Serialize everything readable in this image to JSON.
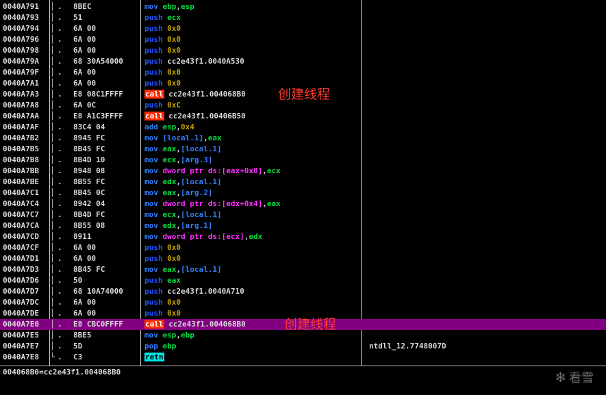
{
  "disasm_rows": [
    {
      "addr": "0040A791",
      "bracket": "│",
      "dot": ".",
      "hex": "8BEC",
      "mnemonic": "mov",
      "m_class": "m-mov",
      "parts": [
        {
          "t": "ebp",
          "c": "o-reg"
        },
        {
          "t": ",",
          "c": "o-target"
        },
        {
          "t": "esp",
          "c": "o-reg"
        }
      ],
      "note": "",
      "comment": ""
    },
    {
      "addr": "0040A793",
      "bracket": "│",
      "dot": ".",
      "hex": "51",
      "mnemonic": "push",
      "m_class": "m-push",
      "parts": [
        {
          "t": "ecx",
          "c": "o-reg"
        }
      ],
      "note": "",
      "comment": ""
    },
    {
      "addr": "0040A794",
      "bracket": "│",
      "dot": ".",
      "hex": "6A 00",
      "mnemonic": "push",
      "m_class": "m-push",
      "parts": [
        {
          "t": "0x0",
          "c": "o-imm"
        }
      ],
      "note": "",
      "comment": ""
    },
    {
      "addr": "0040A796",
      "bracket": "│",
      "dot": ".",
      "hex": "6A 00",
      "mnemonic": "push",
      "m_class": "m-push",
      "parts": [
        {
          "t": "0x0",
          "c": "o-imm"
        }
      ],
      "note": "",
      "comment": ""
    },
    {
      "addr": "0040A798",
      "bracket": "│",
      "dot": ".",
      "hex": "6A 00",
      "mnemonic": "push",
      "m_class": "m-push",
      "parts": [
        {
          "t": "0x0",
          "c": "o-imm"
        }
      ],
      "note": "",
      "comment": ""
    },
    {
      "addr": "0040A79A",
      "bracket": "│",
      "dot": ".",
      "hex": "68 30A54000",
      "mnemonic": "push",
      "m_class": "m-push",
      "parts": [
        {
          "t": "cc2e43f1.0040A530",
          "c": "o-target"
        }
      ],
      "note": "",
      "comment": ""
    },
    {
      "addr": "0040A79F",
      "bracket": "│",
      "dot": ".",
      "hex": "6A 00",
      "mnemonic": "push",
      "m_class": "m-push",
      "parts": [
        {
          "t": "0x0",
          "c": "o-imm"
        }
      ],
      "note": "",
      "comment": ""
    },
    {
      "addr": "0040A7A1",
      "bracket": "│",
      "dot": ".",
      "hex": "6A 00",
      "mnemonic": "push",
      "m_class": "m-push",
      "parts": [
        {
          "t": "0x0",
          "c": "o-imm"
        }
      ],
      "note": "",
      "comment": ""
    },
    {
      "addr": "0040A7A3",
      "bracket": "│",
      "dot": ".",
      "hex": "E8 08C1FFFF",
      "mnemonic": "call",
      "m_class": "m-call",
      "parts": [
        {
          "t": "cc2e43f1.004068B0",
          "c": "o-target"
        }
      ],
      "note": "创建线程",
      "comment": ""
    },
    {
      "addr": "0040A7A8",
      "bracket": "│",
      "dot": ".",
      "hex": "6A 0C",
      "mnemonic": "push",
      "m_class": "m-push",
      "parts": [
        {
          "t": "0xC",
          "c": "o-imm"
        }
      ],
      "note": "",
      "comment": ""
    },
    {
      "addr": "0040A7AA",
      "bracket": "│",
      "dot": ".",
      "hex": "E8 A1C3FFFF",
      "mnemonic": "call",
      "m_class": "m-call",
      "parts": [
        {
          "t": "cc2e43f1.00406B50",
          "c": "o-target"
        }
      ],
      "note": "",
      "comment": ""
    },
    {
      "addr": "0040A7AF",
      "bracket": "│",
      "dot": ".",
      "hex": "83C4 04",
      "mnemonic": "add",
      "m_class": "m-add",
      "parts": [
        {
          "t": "esp",
          "c": "o-reg"
        },
        {
          "t": ",",
          "c": "o-target"
        },
        {
          "t": "0x4",
          "c": "o-imm"
        }
      ],
      "note": "",
      "comment": ""
    },
    {
      "addr": "0040A7B2",
      "bracket": "│",
      "dot": ".",
      "hex": "8945 FC",
      "mnemonic": "mov",
      "m_class": "m-mov",
      "parts": [
        {
          "t": "[local.1]",
          "c": "o-local"
        },
        {
          "t": ",",
          "c": "o-target"
        },
        {
          "t": "eax",
          "c": "o-reg"
        }
      ],
      "note": "",
      "comment": ""
    },
    {
      "addr": "0040A7B5",
      "bracket": "│",
      "dot": ".",
      "hex": "8B45 FC",
      "mnemonic": "mov",
      "m_class": "m-mov",
      "parts": [
        {
          "t": "eax",
          "c": "o-reg"
        },
        {
          "t": ",",
          "c": "o-target"
        },
        {
          "t": "[local.1]",
          "c": "o-local"
        }
      ],
      "note": "",
      "comment": ""
    },
    {
      "addr": "0040A7B8",
      "bracket": "│",
      "dot": ".",
      "hex": "8B4D 10",
      "mnemonic": "mov",
      "m_class": "m-mov",
      "parts": [
        {
          "t": "ecx",
          "c": "o-reg"
        },
        {
          "t": ",",
          "c": "o-target"
        },
        {
          "t": "[arg.3]",
          "c": "o-local"
        }
      ],
      "note": "",
      "comment": ""
    },
    {
      "addr": "0040A7BB",
      "bracket": "│",
      "dot": ".",
      "hex": "8948 08",
      "mnemonic": "mov",
      "m_class": "m-mov",
      "parts": [
        {
          "t": "dword ptr ds:[eax+0x8]",
          "c": "o-dword"
        },
        {
          "t": ",",
          "c": "o-target"
        },
        {
          "t": "ecx",
          "c": "o-reg"
        }
      ],
      "note": "",
      "comment": ""
    },
    {
      "addr": "0040A7BE",
      "bracket": "│",
      "dot": ".",
      "hex": "8B55 FC",
      "mnemonic": "mov",
      "m_class": "m-mov",
      "parts": [
        {
          "t": "edx",
          "c": "o-reg"
        },
        {
          "t": ",",
          "c": "o-target"
        },
        {
          "t": "[local.1]",
          "c": "o-local"
        }
      ],
      "note": "",
      "comment": ""
    },
    {
      "addr": "0040A7C1",
      "bracket": "│",
      "dot": ".",
      "hex": "8B45 0C",
      "mnemonic": "mov",
      "m_class": "m-mov",
      "parts": [
        {
          "t": "eax",
          "c": "o-reg"
        },
        {
          "t": ",",
          "c": "o-target"
        },
        {
          "t": "[arg.2]",
          "c": "o-local"
        }
      ],
      "note": "",
      "comment": ""
    },
    {
      "addr": "0040A7C4",
      "bracket": "│",
      "dot": ".",
      "hex": "8942 04",
      "mnemonic": "mov",
      "m_class": "m-mov",
      "parts": [
        {
          "t": "dword ptr ds:[edx+0x4]",
          "c": "o-dword"
        },
        {
          "t": ",",
          "c": "o-target"
        },
        {
          "t": "eax",
          "c": "o-reg"
        }
      ],
      "note": "",
      "comment": ""
    },
    {
      "addr": "0040A7C7",
      "bracket": "│",
      "dot": ".",
      "hex": "8B4D FC",
      "mnemonic": "mov",
      "m_class": "m-mov",
      "parts": [
        {
          "t": "ecx",
          "c": "o-reg"
        },
        {
          "t": ",",
          "c": "o-target"
        },
        {
          "t": "[local.1]",
          "c": "o-local"
        }
      ],
      "note": "",
      "comment": ""
    },
    {
      "addr": "0040A7CA",
      "bracket": "│",
      "dot": ".",
      "hex": "8B55 08",
      "mnemonic": "mov",
      "m_class": "m-mov",
      "parts": [
        {
          "t": "edx",
          "c": "o-reg"
        },
        {
          "t": ",",
          "c": "o-target"
        },
        {
          "t": "[arg.1]",
          "c": "o-local"
        }
      ],
      "note": "",
      "comment": ""
    },
    {
      "addr": "0040A7CD",
      "bracket": "│",
      "dot": ".",
      "hex": "8911",
      "mnemonic": "mov",
      "m_class": "m-mov",
      "parts": [
        {
          "t": "dword ptr ds:[ecx]",
          "c": "o-dword"
        },
        {
          "t": ",",
          "c": "o-target"
        },
        {
          "t": "edx",
          "c": "o-reg"
        }
      ],
      "note": "",
      "comment": ""
    },
    {
      "addr": "0040A7CF",
      "bracket": "│",
      "dot": ".",
      "hex": "6A 00",
      "mnemonic": "push",
      "m_class": "m-push",
      "parts": [
        {
          "t": "0x0",
          "c": "o-imm"
        }
      ],
      "note": "",
      "comment": ""
    },
    {
      "addr": "0040A7D1",
      "bracket": "│",
      "dot": ".",
      "hex": "6A 00",
      "mnemonic": "push",
      "m_class": "m-push",
      "parts": [
        {
          "t": "0x0",
          "c": "o-imm"
        }
      ],
      "note": "",
      "comment": ""
    },
    {
      "addr": "0040A7D3",
      "bracket": "│",
      "dot": ".",
      "hex": "8B45 FC",
      "mnemonic": "mov",
      "m_class": "m-mov",
      "parts": [
        {
          "t": "eax",
          "c": "o-reg"
        },
        {
          "t": ",",
          "c": "o-target"
        },
        {
          "t": "[local.1]",
          "c": "o-local"
        }
      ],
      "note": "",
      "comment": ""
    },
    {
      "addr": "0040A7D6",
      "bracket": "│",
      "dot": ".",
      "hex": "50",
      "mnemonic": "push",
      "m_class": "m-push",
      "parts": [
        {
          "t": "eax",
          "c": "o-reg"
        }
      ],
      "note": "",
      "comment": ""
    },
    {
      "addr": "0040A7D7",
      "bracket": "│",
      "dot": ".",
      "hex": "68 10A74000",
      "mnemonic": "push",
      "m_class": "m-push",
      "parts": [
        {
          "t": "cc2e43f1.0040A710",
          "c": "o-target"
        }
      ],
      "note": "",
      "comment": ""
    },
    {
      "addr": "0040A7DC",
      "bracket": "│",
      "dot": ".",
      "hex": "6A 00",
      "mnemonic": "push",
      "m_class": "m-push",
      "parts": [
        {
          "t": "0x0",
          "c": "o-imm"
        }
      ],
      "note": "",
      "comment": ""
    },
    {
      "addr": "0040A7DE",
      "bracket": "│",
      "dot": ".",
      "hex": "6A 00",
      "mnemonic": "push",
      "m_class": "m-push",
      "parts": [
        {
          "t": "0x0",
          "c": "o-imm"
        }
      ],
      "note": "",
      "comment": ""
    },
    {
      "addr": "0040A7E0",
      "bracket": "│",
      "dot": ".",
      "hex": "E8 CBC0FFFF",
      "mnemonic": "call",
      "m_class": "m-call",
      "parts": [
        {
          "t": "cc2e43f1.004068B0",
          "c": "o-target"
        }
      ],
      "note": "创建线程",
      "comment": "",
      "selected": true
    },
    {
      "addr": "0040A7E5",
      "bracket": "│",
      "dot": ".",
      "hex": "8BE5",
      "mnemonic": "mov",
      "m_class": "m-mov",
      "parts": [
        {
          "t": "esp",
          "c": "o-reg"
        },
        {
          "t": ",",
          "c": "o-target"
        },
        {
          "t": "ebp",
          "c": "o-reg"
        }
      ],
      "note": "",
      "comment": ""
    },
    {
      "addr": "0040A7E7",
      "bracket": "│",
      "dot": ".",
      "hex": "5D",
      "mnemonic": "pop",
      "m_class": "m-pop",
      "parts": [
        {
          "t": "ebp",
          "c": "o-reg"
        }
      ],
      "note": "",
      "comment": "ntdll_12.7748007D"
    },
    {
      "addr": "0040A7E8",
      "bracket": "└",
      "dot": ".",
      "hex": "C3",
      "mnemonic": "retn",
      "m_class": "m-retn",
      "parts": [],
      "note": "",
      "comment": ""
    }
  ],
  "info_bar": {
    "text": "004068B0=cc2e43f1.004068B0"
  },
  "watermark": {
    "icon": "snowflake-icon",
    "text": "看雪"
  },
  "colors": {
    "background": "#000000",
    "selection": "#800080",
    "call_highlight": "#ff2a00",
    "retn_highlight": "#00e5e5",
    "register": "#00e040",
    "immediate": "#c0a000",
    "memory_operand": "#ff30ff",
    "annotation": "#ff3b30"
  }
}
